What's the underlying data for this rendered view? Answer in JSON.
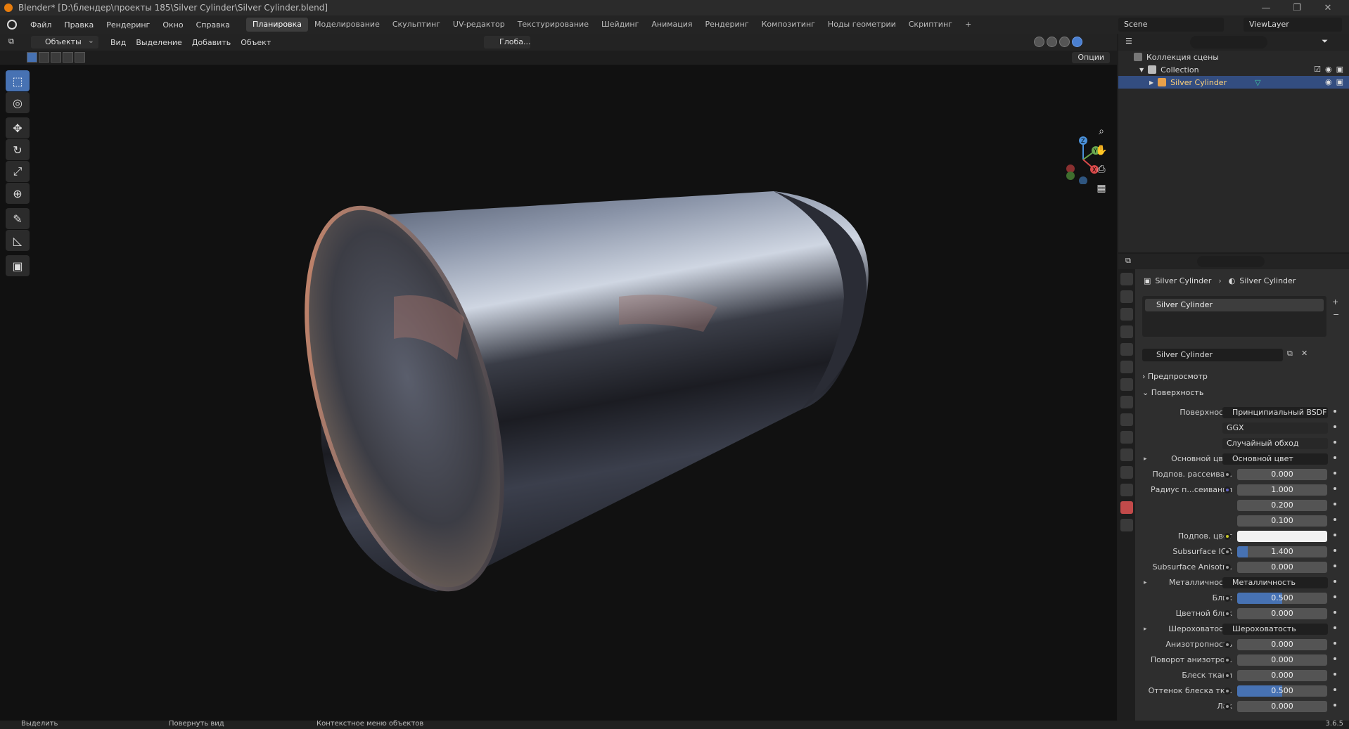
{
  "window": {
    "title": "Blender* [D:\\блендер\\проекты 185\\Silver Cylinder\\Silver Cylinder.blend]",
    "controls": [
      "—",
      "❐",
      "✕"
    ]
  },
  "menu": {
    "items": [
      "Файл",
      "Правка",
      "Рендеринг",
      "Окно",
      "Справка"
    ],
    "workspaces": [
      "Планировка",
      "Моделирование",
      "Скульптинг",
      "UV-редактор",
      "Текстурирование",
      "Шейдинг",
      "Анимация",
      "Рендеринг",
      "Композитинг",
      "Ноды геометрии",
      "Скриптинг"
    ],
    "active_workspace": "Планировка",
    "add_label": "+",
    "scene": "Scene",
    "view_layer": "ViewLayer"
  },
  "viewport_header": {
    "mode": "Объекты",
    "items": [
      "Вид",
      "Выделение",
      "Добавить",
      "Объект"
    ],
    "transform_orientation": "Глоба...",
    "options": "Опции"
  },
  "toolbar": {
    "tools": [
      {
        "name": "select-box-tool",
        "icon": "⬚",
        "active": true
      },
      {
        "name": "cursor-tool",
        "icon": "◎",
        "active": false
      },
      {
        "name": "move-tool",
        "icon": "✥",
        "active": false
      },
      {
        "name": "rotate-tool",
        "icon": "↻",
        "active": false
      },
      {
        "name": "scale-tool",
        "icon": "⤢",
        "active": false
      },
      {
        "name": "transform-tool",
        "icon": "⊕",
        "active": false
      },
      {
        "name": "annotate-tool",
        "icon": "✎",
        "active": false
      },
      {
        "name": "measure-tool",
        "icon": "📐",
        "active": false
      },
      {
        "name": "add-cube-tool",
        "icon": "▣",
        "active": false
      }
    ]
  },
  "gizmo": {
    "x": "X",
    "y": "Y",
    "z": "Z"
  },
  "outliner": {
    "scene_collection": "Коллекция сцены",
    "collection": "Collection",
    "object": "Silver Cylinder"
  },
  "properties": {
    "breadcrumb_object": "Silver Cylinder",
    "breadcrumb_material": "Silver Cylinder",
    "slot_name": "Silver Cylinder",
    "material_name": "Silver Cylinder",
    "panel_preview": "Предпросмотр",
    "panel_surface": "Поверхность",
    "rows": [
      {
        "label": "Поверхность",
        "kind": "box",
        "value": "Принципиальный BSDF",
        "sock": "#3cb371"
      },
      {
        "label": "",
        "kind": "drop",
        "value": "GGX"
      },
      {
        "label": "",
        "kind": "drop",
        "value": "Случайный обход"
      },
      {
        "label": "Основной цвет",
        "kind": "box",
        "value": "Основной цвет",
        "sock": "#c7c729",
        "arrow": true
      },
      {
        "label": "Подпов. рассеива...",
        "kind": "field",
        "value": "0.000",
        "fill": 0,
        "sock": "#9a9a9a"
      },
      {
        "label": "Радиус п...сеивания",
        "kind": "field",
        "value": "1.000",
        "fill": 0,
        "sock": "#6363c7"
      },
      {
        "label": "",
        "kind": "field",
        "value": "0.200",
        "fill": 0
      },
      {
        "label": "",
        "kind": "field",
        "value": "0.100",
        "fill": 0
      },
      {
        "label": "Подпов. цвет",
        "kind": "color",
        "value": "",
        "sock": "#c7c729"
      },
      {
        "label": "Subsurface IOR",
        "kind": "field",
        "value": "1.400",
        "fill": 0.12,
        "sock": "#9a9a9a"
      },
      {
        "label": "Subsurface Anisotr...",
        "kind": "field",
        "value": "0.000",
        "fill": 0,
        "sock": "#9a9a9a"
      },
      {
        "label": "Металличность",
        "kind": "box",
        "value": "Металличность",
        "sock": "#9a9a9a",
        "arrow": true
      },
      {
        "label": "Блик",
        "kind": "field",
        "value": "0.500",
        "fill": 0.5,
        "sock": "#9a9a9a"
      },
      {
        "label": "Цветной блик",
        "kind": "field",
        "value": "0.000",
        "fill": 0,
        "sock": "#9a9a9a"
      },
      {
        "label": "Шероховатость",
        "kind": "box",
        "value": "Шероховатость",
        "sock": "#9a9a9a",
        "arrow": true
      },
      {
        "label": "Анизотропность",
        "kind": "field",
        "value": "0.000",
        "fill": 0,
        "sock": "#9a9a9a"
      },
      {
        "label": "Поворот анизотро...",
        "kind": "field",
        "value": "0.000",
        "fill": 0,
        "sock": "#9a9a9a"
      },
      {
        "label": "Блеск ткани",
        "kind": "field",
        "value": "0.000",
        "fill": 0,
        "sock": "#9a9a9a"
      },
      {
        "label": "Оттенок блеска тк...",
        "kind": "field",
        "value": "0.500",
        "fill": 0.5,
        "sock": "#9a9a9a"
      },
      {
        "label": "Лак",
        "kind": "field",
        "value": "0.000",
        "fill": 0,
        "sock": "#9a9a9a"
      }
    ]
  },
  "status": {
    "select": "Выделить",
    "rotate_view": "Повернуть вид",
    "context_menu": "Контекстное меню объектов",
    "version": "3.6.5"
  },
  "colors": {
    "accent": "#4772b3",
    "selected_row": "#334d80",
    "material_tab": "#c24a4a"
  }
}
